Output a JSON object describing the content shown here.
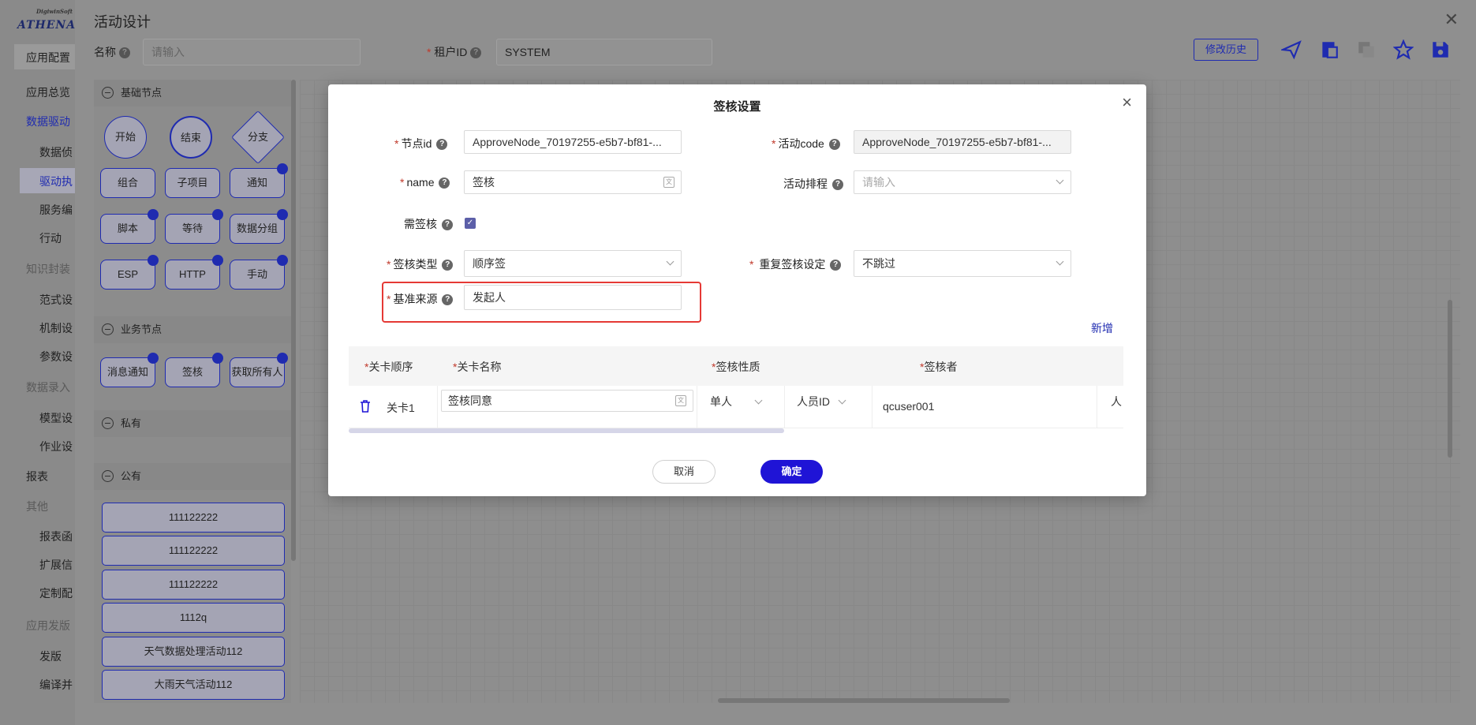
{
  "brand": {
    "logo_top": "DigiwinSoft",
    "logo_main": "ATHENA"
  },
  "left_nav": {
    "items": [
      {
        "label": "应用配置",
        "level": 0,
        "state": "header"
      },
      {
        "label": "应用总览",
        "level": 0,
        "state": "normal"
      },
      {
        "label": "数据驱动",
        "level": 0,
        "state": "active-parent"
      },
      {
        "label": "数据侦",
        "level": 1,
        "state": "normal"
      },
      {
        "label": "驱动执",
        "level": 1,
        "state": "active"
      },
      {
        "label": "服务编",
        "level": 1,
        "state": "normal"
      },
      {
        "label": "行动",
        "level": 1,
        "state": "normal"
      },
      {
        "label": "知识封装",
        "level": 0,
        "state": "muted"
      },
      {
        "label": "范式设",
        "level": 1,
        "state": "normal"
      },
      {
        "label": "机制设",
        "level": 1,
        "state": "normal"
      },
      {
        "label": "参数设",
        "level": 1,
        "state": "normal"
      },
      {
        "label": "数据录入",
        "level": 0,
        "state": "muted"
      },
      {
        "label": "模型设",
        "level": 1,
        "state": "normal"
      },
      {
        "label": "作业设",
        "level": 1,
        "state": "normal"
      },
      {
        "label": "报表",
        "level": 0,
        "state": "normal"
      },
      {
        "label": "其他",
        "level": 0,
        "state": "muted"
      },
      {
        "label": "报表函",
        "level": 1,
        "state": "normal"
      },
      {
        "label": "扩展信",
        "level": 1,
        "state": "normal"
      },
      {
        "label": "定制配",
        "level": 1,
        "state": "normal"
      },
      {
        "label": "应用发版",
        "level": 0,
        "state": "muted"
      },
      {
        "label": "发版",
        "level": 1,
        "state": "normal"
      },
      {
        "label": "编译并",
        "level": 1,
        "state": "normal"
      }
    ]
  },
  "design": {
    "title": "活动设计",
    "name_label": "名称",
    "name_placeholder": "请输入",
    "tenant_label": "租户ID",
    "tenant_value": "SYSTEM",
    "history_button": "修改历史",
    "toolbar_icons": [
      "send-icon",
      "paste-icon",
      "copy-icon",
      "star-icon",
      "save-icon"
    ]
  },
  "palette": {
    "basic_title": "基础节点",
    "basic_nodes": [
      "开始",
      "结束",
      "分支",
      "组合",
      "子项目",
      "通知",
      "脚本",
      "等待",
      "数据分组",
      "ESP",
      "HTTP",
      "手动"
    ],
    "business_title": "业务节点",
    "business_nodes": [
      "消息通知",
      "签核",
      "获取所有人"
    ],
    "private_title": "私有",
    "public_title": "公有",
    "public_items": [
      "111122222",
      "111122222",
      "111122222",
      "1112q",
      "天气数据处理活动112",
      "大雨天气活动112"
    ]
  },
  "modal": {
    "title": "签核设置",
    "node_id_label": "节点id",
    "node_id_value": "ApproveNode_70197255-e5b7-bf81-...",
    "activity_code_label": "活动code",
    "activity_code_value": "ApproveNode_70197255-e5b7-bf81-...",
    "name_label": "name",
    "name_value": "签核",
    "schedule_label": "活动排程",
    "schedule_placeholder": "请输入",
    "need_approve_label": "需签核",
    "need_approve_checked": true,
    "approve_type_label": "签核类型",
    "approve_type_value": "顺序签",
    "repeat_label": "重复签核设定",
    "repeat_value": "不跳过",
    "base_source_label": "基准来源",
    "base_source_value": "发起人",
    "add_link": "新增",
    "table": {
      "headers": [
        "关卡顺序",
        "关卡名称",
        "签核性质",
        "签核者"
      ],
      "rows": [
        {
          "order": "关卡1",
          "name": "签核同意",
          "nature": "单人",
          "approver_type": "人员ID",
          "approver": "qcuser001",
          "extra": "人"
        }
      ]
    },
    "cancel_button": "取消",
    "ok_button": "确定"
  },
  "colors": {
    "accent": "#1f14d6",
    "highlight": "#e53935",
    "required": "#c0392b"
  }
}
